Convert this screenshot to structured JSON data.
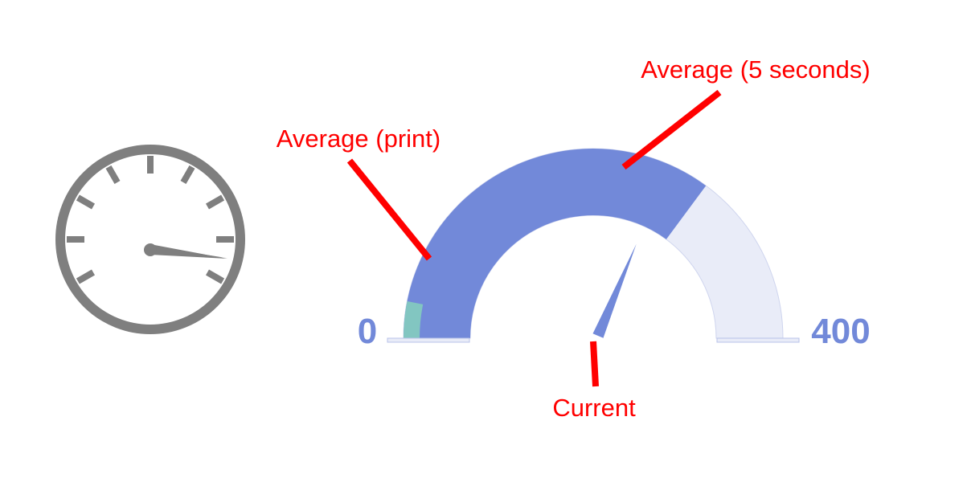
{
  "icon": {
    "name": "speedometer-icon",
    "color": "#7f7f7f"
  },
  "gauge": {
    "min_label": "0",
    "max_label": "400",
    "min_value": 0,
    "max_value": 400,
    "average_5s_value": 281,
    "average_print_value": 25,
    "current_value": 260,
    "colors": {
      "average_5s": "#7289d9",
      "average_print": "#82c6c1",
      "track": "#e9ecf8",
      "needle": "#7289d9",
      "scale_label": "#7289d9"
    }
  },
  "callouts": {
    "color": "#ff0000",
    "average_print": "Average (print)",
    "average_5s": "Average (5 seconds)",
    "current": "Current"
  }
}
